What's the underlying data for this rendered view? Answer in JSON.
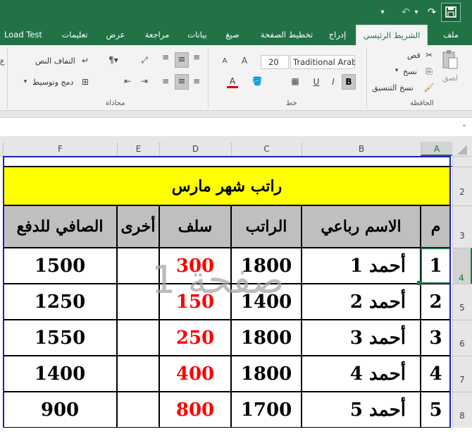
{
  "titlebar": {
    "save_icon": "floppy-disk-icon",
    "redo_icon": "↷",
    "undo_icon": "↶",
    "undo_dropdown": "▾",
    "qat_dropdown": "▾"
  },
  "tabs": [
    "ملف",
    "الشريط الرئيسي",
    "إدراج",
    "تخطيط الصفحة",
    "صيغ",
    "بيانات",
    "مراجعة",
    "عرض",
    "تعليمات",
    "Load Test"
  ],
  "ribbon": {
    "clipboard": {
      "group_label": "الحافظة",
      "paste_label": "لصق",
      "cut_label": "قص",
      "copy_label": "نسخ",
      "format_painter_label": "نسخ التنسيق"
    },
    "font": {
      "group_label": "خط",
      "font_name": "Traditional Arabic",
      "font_size": "20",
      "bold": "B",
      "italic": "I",
      "underline": "U",
      "font_color_letter": "A",
      "increase_font": "A",
      "decrease_font": "A"
    },
    "alignment": {
      "group_label": "محاذاة",
      "wrap_text_label": "التفاف النص",
      "merge_center_label": "دمج وتوسيط",
      "cut_off_left": "ع"
    }
  },
  "columns": {
    "A": "A",
    "B": "B",
    "C": "C",
    "D": "D",
    "E": "E",
    "F": "F"
  },
  "rows": [
    "2",
    "3",
    "4",
    "5",
    "6",
    "7",
    "8"
  ],
  "sheet": {
    "title": "راتب شهر مارس",
    "headers": {
      "num": "م",
      "name": "الاسم رباعي",
      "salary": "الراتب",
      "advance": "سلف",
      "other": "أخرى",
      "net": "الصافي للدفع"
    },
    "records": [
      {
        "num": "1",
        "name": "أحمد 1",
        "salary": "1800",
        "advance": "300",
        "other": "",
        "net": "1500"
      },
      {
        "num": "2",
        "name": "أحمد 2",
        "salary": "1400",
        "advance": "150",
        "other": "",
        "net": "1250"
      },
      {
        "num": "3",
        "name": "أحمد 3",
        "salary": "1800",
        "advance": "250",
        "other": "",
        "net": "1550"
      },
      {
        "num": "4",
        "name": "أحمد 4",
        "salary": "1800",
        "advance": "400",
        "other": "",
        "net": "1400"
      },
      {
        "num": "5",
        "name": "أحمد 5",
        "salary": "1700",
        "advance": "800",
        "other": "",
        "net": "900"
      }
    ],
    "watermark": "صفحة 1"
  }
}
